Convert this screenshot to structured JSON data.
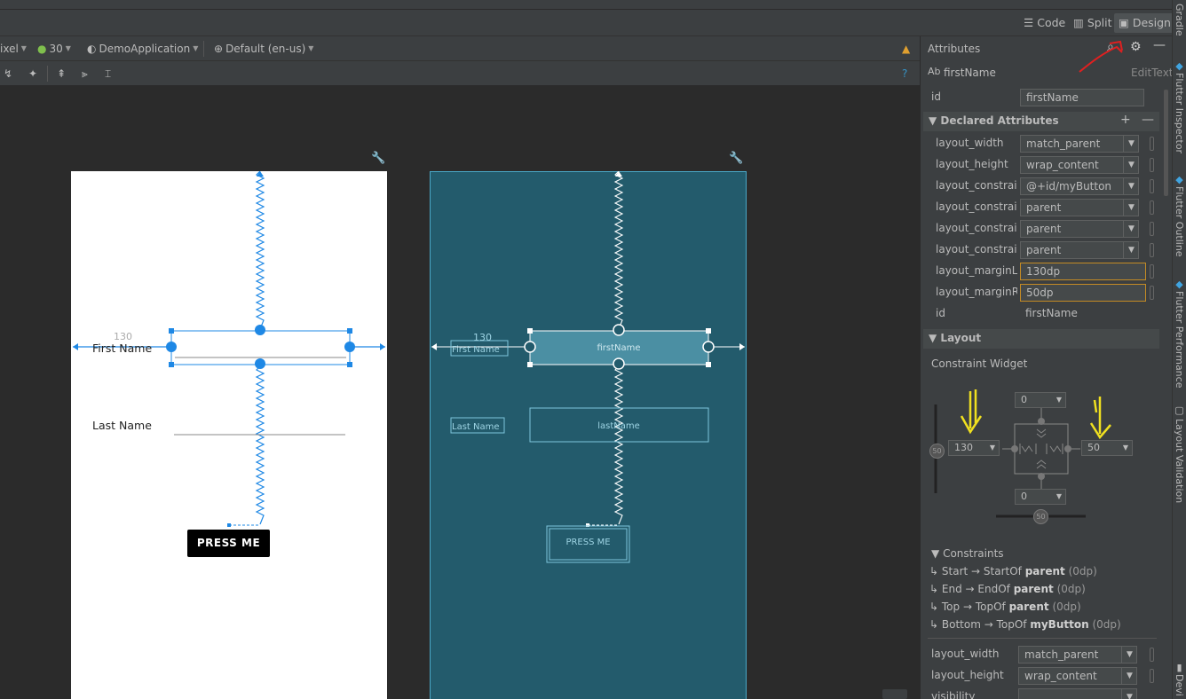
{
  "mode_bar": {
    "code": "Code",
    "split": "Split",
    "design": "Design"
  },
  "toolbar": {
    "device": "ixel",
    "api": "30",
    "app": "DemoApplication",
    "locale": "Default (en-us)"
  },
  "attributes": {
    "title": "Attributes",
    "component_name": "firstName",
    "component_type": "EditText",
    "id_label": "id",
    "id_value": "firstName",
    "declared_header": "Declared Attributes",
    "declared": [
      {
        "label": "layout_width",
        "value": "match_parent"
      },
      {
        "label": "layout_height",
        "value": "wrap_content"
      },
      {
        "label": "layout_constrai...",
        "value": "@+id/myButton"
      },
      {
        "label": "layout_constrai...",
        "value": "parent"
      },
      {
        "label": "layout_constrai...",
        "value": "parent"
      },
      {
        "label": "layout_constrai...",
        "value": "parent"
      },
      {
        "label": "layout_marginL...",
        "value": "130dp"
      },
      {
        "label": "layout_marginR...",
        "value": "50dp"
      },
      {
        "label": "id",
        "value": "firstName"
      }
    ],
    "layout_header": "Layout",
    "constraint_widget_label": "Constraint Widget",
    "cw_top": "0",
    "cw_bottom": "0",
    "cw_left": "130",
    "cw_right": "50",
    "bias_v": "50",
    "bias_h": "50",
    "constraints_header": "Constraints",
    "constraints": [
      {
        "from": "Start",
        "to": "StartOf",
        "target": "parent",
        "margin": "(0dp)"
      },
      {
        "from": "End",
        "to": "EndOf",
        "target": "parent",
        "margin": "(0dp)"
      },
      {
        "from": "Top",
        "to": "TopOf",
        "target": "parent",
        "margin": "(0dp)"
      },
      {
        "from": "Bottom",
        "to": "TopOf",
        "target": "myButton",
        "margin": "(0dp)"
      }
    ],
    "bottom_rows": [
      {
        "label": "layout_width",
        "value": "match_parent"
      },
      {
        "label": "layout_height",
        "value": "wrap_content"
      },
      {
        "label": "visibility",
        "value": ""
      }
    ]
  },
  "design_preview": {
    "margin_label": "130",
    "first_name_label": "First Name",
    "last_name_label": "Last Name",
    "button_label": "PRESS ME"
  },
  "blueprint_preview": {
    "margin_label": "130",
    "first_name_label": "First Name",
    "last_name_label": "Last Name",
    "first_name_field": "firstName",
    "last_name_field": "lastName",
    "button_label": "PRESS ME"
  },
  "right_strip": [
    "Gradle",
    "Flutter Inspector",
    "Flutter Outline",
    "Flutter Performance",
    "Layout Validation",
    "Devi"
  ]
}
